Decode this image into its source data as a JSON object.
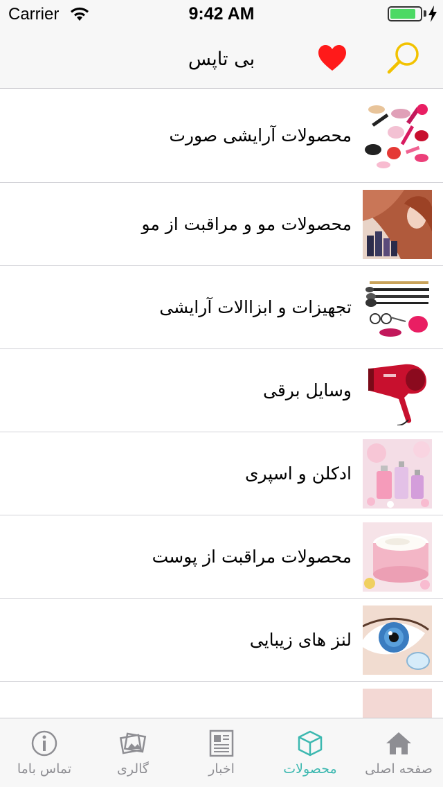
{
  "status_bar": {
    "carrier": "Carrier",
    "time": "9:42 AM",
    "battery_level": 0.85,
    "battery_color": "#4cd964"
  },
  "navbar": {
    "title": "بی تاپس",
    "favorite_icon": "heart-icon",
    "search_icon": "search-icon",
    "heart_color": "#ff1a1a",
    "search_color": "#f2c200"
  },
  "categories": [
    {
      "label": "محصولات آرایشی صورت",
      "icon": "makeup-thumbnail"
    },
    {
      "label": "محصولات مو و مراقبت از مو",
      "icon": "hair-care-thumbnail"
    },
    {
      "label": "تجهیزات و ابزاالات آرایشی",
      "icon": "makeup-tools-thumbnail"
    },
    {
      "label": "وسایل برقی",
      "icon": "hair-dryer-thumbnail"
    },
    {
      "label": "ادکلن و اسپری",
      "icon": "perfume-thumbnail"
    },
    {
      "label": "محصولات مراقبت از پوست",
      "icon": "skin-cream-thumbnail"
    },
    {
      "label": "لنز های زیبایی",
      "icon": "contact-lens-thumbnail"
    },
    {
      "label": "",
      "icon": "lips-thumbnail"
    }
  ],
  "tabbar": {
    "active_color": "#3cb8b0",
    "inactive_color": "#8e8e93",
    "tabs": [
      {
        "label": "تماس باما",
        "icon": "info-icon"
      },
      {
        "label": "گالری",
        "icon": "gallery-icon"
      },
      {
        "label": "اخبار",
        "icon": "newspaper-icon"
      },
      {
        "label": "محصولات",
        "icon": "box-icon",
        "active": true
      },
      {
        "label": "صفحه اصلی",
        "icon": "home-icon"
      }
    ]
  }
}
